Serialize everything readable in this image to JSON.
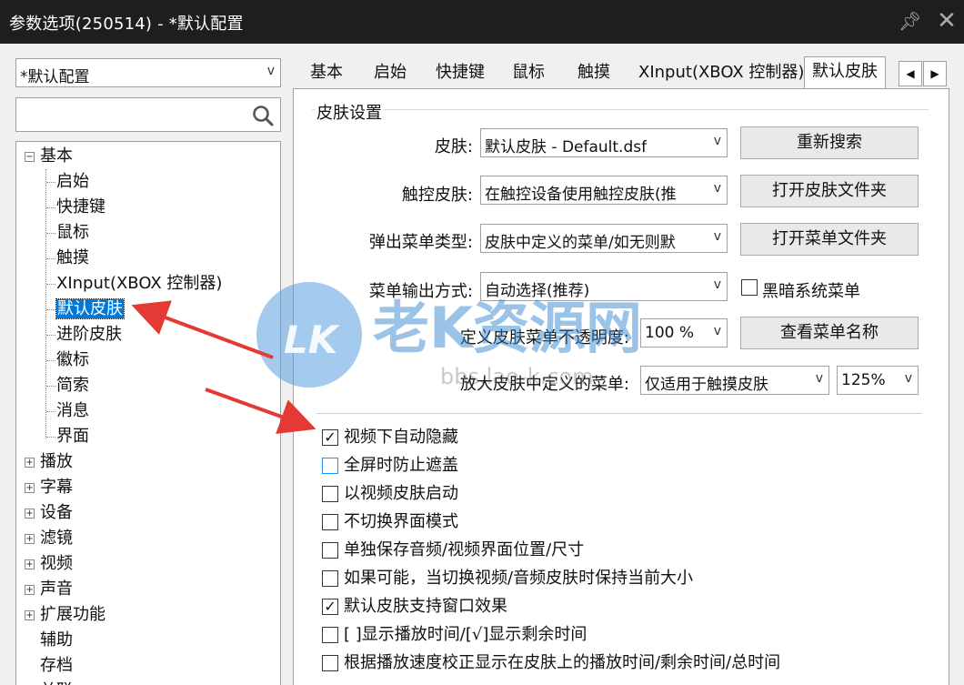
{
  "window": {
    "title": "参数选项(250514) - *默认配置"
  },
  "profile": {
    "value": "*默认配置"
  },
  "search": {
    "placeholder": ""
  },
  "tree": {
    "root_basic": "基本",
    "basic_children": [
      "启始",
      "快捷键",
      "鼠标",
      "触摸",
      "XInput(XBOX 控制器)",
      "默认皮肤",
      "进阶皮肤",
      "徽标",
      "简索",
      "消息",
      "界面"
    ],
    "roots": [
      "播放",
      "字幕",
      "设备",
      "滤镜",
      "视频",
      "声音",
      "扩展功能"
    ],
    "plain_roots": [
      "辅助",
      "存档",
      "关联"
    ]
  },
  "tabs": [
    "基本",
    "启始",
    "快捷键",
    "鼠标",
    "触摸",
    "XInput(XBOX 控制器)",
    "默认皮肤"
  ],
  "skin_settings": {
    "legend": "皮肤设置",
    "skin_label": "皮肤:",
    "skin_value": "默认皮肤 - Default.dsf",
    "touch_skin_label": "触控皮肤:",
    "touch_skin_value": "在触控设备使用触控皮肤(推",
    "popup_menu_label": "弹出菜单类型:",
    "popup_menu_value": "皮肤中定义的菜单/如无则默",
    "menu_output_label": "菜单输出方式:",
    "menu_output_value": "自动选择(推荐)",
    "opacity_label": "定义皮肤菜单不透明度:",
    "opacity_value": "100 %",
    "enlarge_label": "放大皮肤中定义的菜单:",
    "enlarge_value": "仅适用于触摸皮肤",
    "enlarge_scale": "125%",
    "btn_research": "重新搜索",
    "btn_open_skin_folder": "打开皮肤文件夹",
    "btn_open_menu_folder": "打开菜单文件夹",
    "dark_menu_label": "黑暗系统菜单",
    "btn_view_menu_names": "查看菜单名称"
  },
  "options": [
    {
      "label": "视频下自动隐藏",
      "checked": true
    },
    {
      "label": "全屏时防止遮盖",
      "checked": false
    },
    {
      "label": "以视频皮肤启动",
      "checked": false
    },
    {
      "label": "不切换界面模式",
      "checked": false
    },
    {
      "label": "单独保存音频/视频界面位置/尺寸",
      "checked": false
    },
    {
      "label": "如果可能，当切换视频/音频皮肤时保持当前大小",
      "checked": false
    },
    {
      "label": "默认皮肤支持窗口效果",
      "checked": true
    },
    {
      "label": "[ ]显示播放时间/[√]显示剩余时间",
      "checked": false
    },
    {
      "label": "根据播放速度校正显示在皮肤上的播放时间/剩余时间/总时间",
      "checked": false
    }
  ],
  "watermark": {
    "logo": "LK",
    "text": "老K资源网",
    "sub": "bbs.lao-k.com"
  },
  "colors": {
    "titlebar": "#1e1e1e",
    "selection": "#0078d7",
    "annotation_arrow": "#e53935"
  }
}
